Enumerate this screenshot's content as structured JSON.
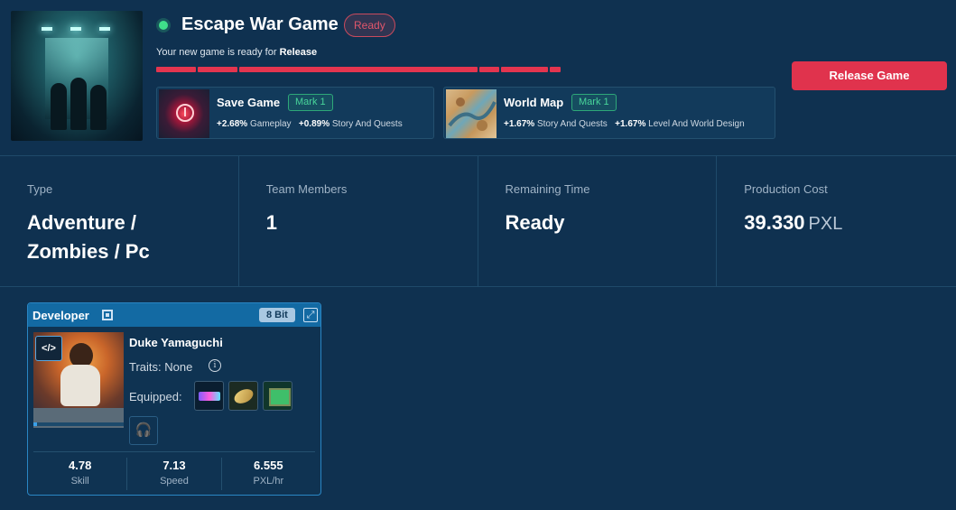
{
  "game": {
    "title": "Escape War Game",
    "status_badge": "Ready",
    "subtitle_prefix": "Your new game is ready for",
    "subtitle_stage": "Release",
    "progress_fraction": 1.0,
    "release_button": "Release Game"
  },
  "features": [
    {
      "name": "Save Game",
      "mark": "Mark 1",
      "stat1_value": "+2.68%",
      "stat1_label": "Gameplay",
      "stat2_value": "+0.89%",
      "stat2_label": "Story And Quests"
    },
    {
      "name": "World Map",
      "mark": "Mark 1",
      "stat1_value": "+1.67%",
      "stat1_label": "Story And Quests",
      "stat2_value": "+1.67%",
      "stat2_label": "Level And World Design"
    }
  ],
  "info": {
    "type_label": "Type",
    "type_value_line1": "Adventure /",
    "type_value_line2": "Zombies / Pc",
    "team_label": "Team Members",
    "team_value": "1",
    "time_label": "Remaining Time",
    "time_value": "Ready",
    "cost_label": "Production Cost",
    "cost_value": "39.330",
    "cost_unit": "PXL"
  },
  "developer_card": {
    "title": "Developer",
    "bit_badge": "8 Bit",
    "name": "Duke Yamaguchi",
    "traits": "Traits: None",
    "equipped_label": "Equipped:",
    "equipped_items": [
      "keyboard-icon",
      "mouse-icon",
      "monitor-icon"
    ],
    "empty_slot": "headset-icon",
    "stats": [
      {
        "value": "4.78",
        "label": "Skill"
      },
      {
        "value": "7.13",
        "label": "Speed"
      },
      {
        "value": "6.555",
        "label": "PXL/hr"
      }
    ]
  },
  "colors": {
    "background": "#0f3150",
    "accent_red": "#e0334d",
    "status_green": "#3fe08a",
    "mark_green": "#48d59a",
    "card_header_blue": "#136aa3"
  }
}
